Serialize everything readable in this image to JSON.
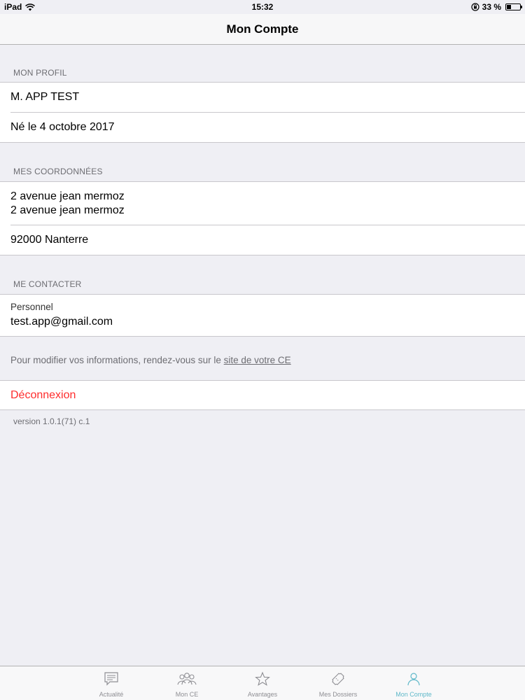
{
  "status_bar": {
    "device": "iPad",
    "time": "15:32",
    "battery": "33 %",
    "battery_level": 0.33
  },
  "nav": {
    "title": "Mon Compte"
  },
  "profile": {
    "header": "MON PROFIL",
    "name": "M. APP TEST",
    "birth": "Né le 4 octobre 2017"
  },
  "coordinates": {
    "header": "MES COORDONNÉES",
    "address_line1": "2 avenue jean mermoz",
    "address_line2": "2 avenue jean mermoz",
    "city": "92000 Nanterre"
  },
  "contact": {
    "header": "ME CONTACTER",
    "label": "Personnel",
    "email": "test.app@gmail.com"
  },
  "info": {
    "text": "Pour modifier vos informations, rendez-vous sur le ",
    "link": "site de votre CE"
  },
  "logout": {
    "label": "Déconnexion"
  },
  "version": "version 1.0.1(71) c.1",
  "tabs": [
    {
      "label": "Actualité",
      "icon": "news-icon"
    },
    {
      "label": "Mon CE",
      "icon": "group-icon"
    },
    {
      "label": "Avantages",
      "icon": "star-icon"
    },
    {
      "label": "Mes Dossiers",
      "icon": "ticket-icon"
    },
    {
      "label": "Mon Compte",
      "icon": "person-icon",
      "active": true
    }
  ],
  "colors": {
    "accent": "#5fb8c9",
    "destructive": "#fe2c2c",
    "background": "#efeff4"
  }
}
